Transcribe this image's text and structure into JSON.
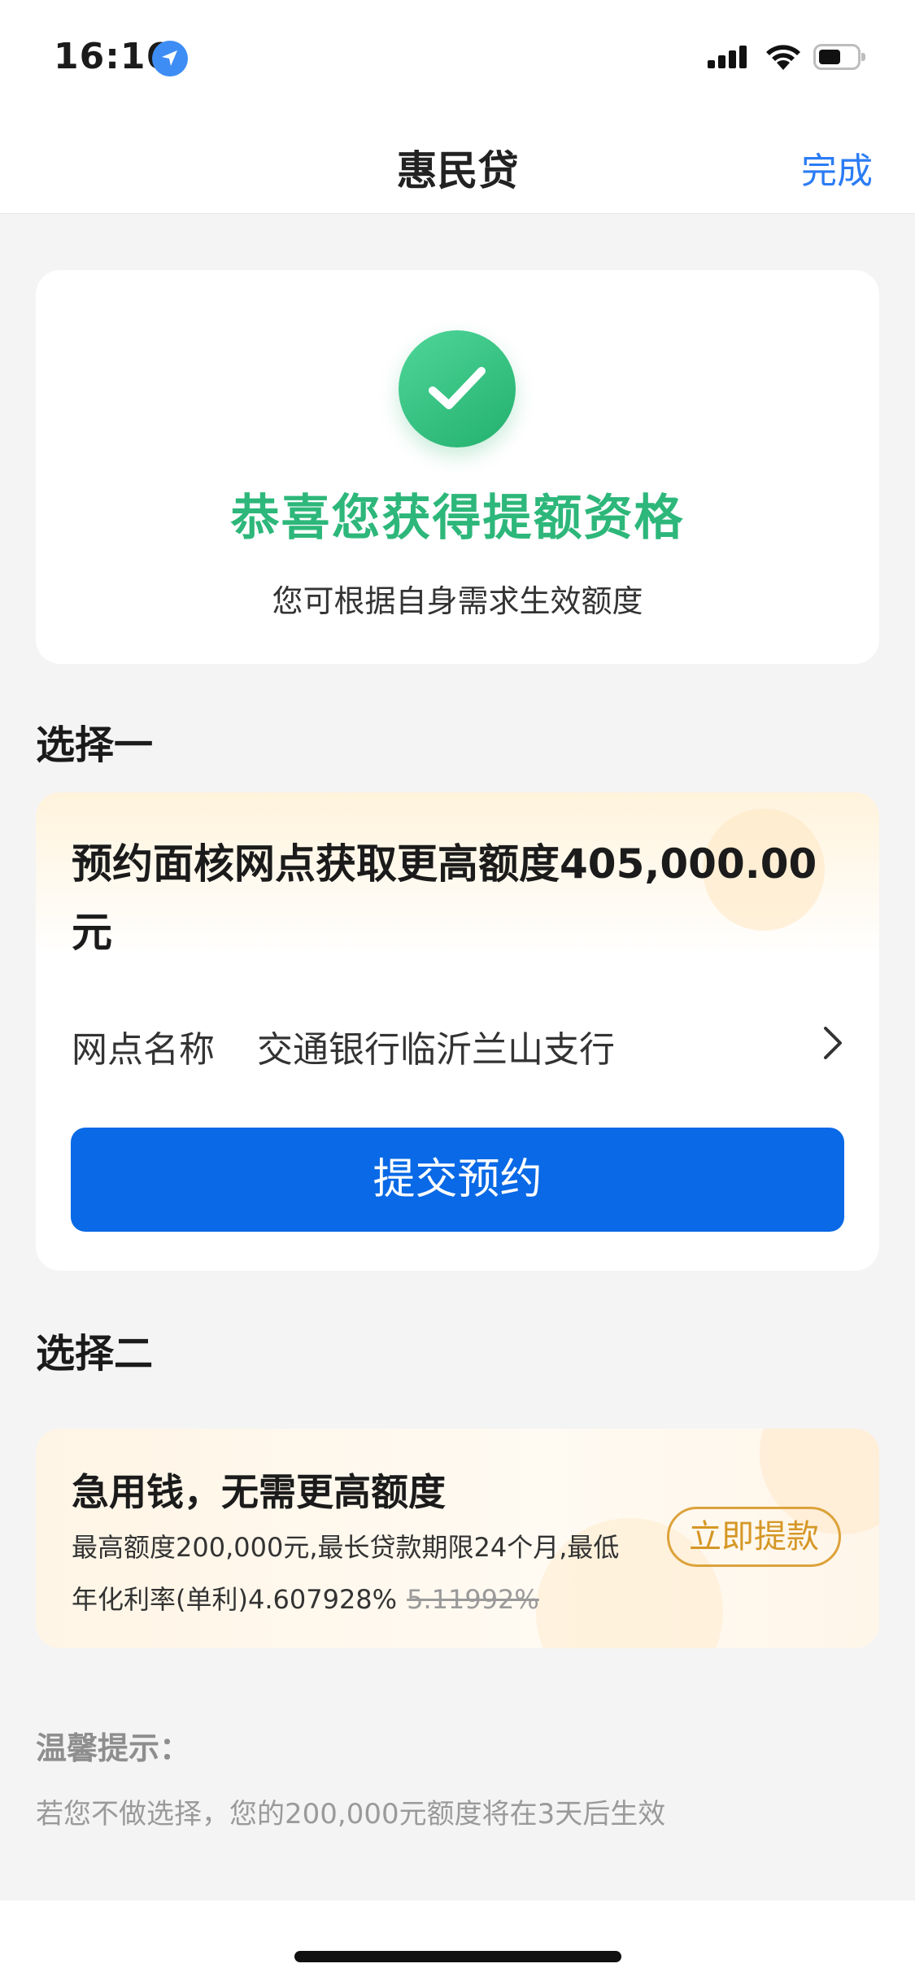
{
  "status_bar": {
    "time": "16:16"
  },
  "nav": {
    "title": "惠民贷",
    "done_label": "完成"
  },
  "success": {
    "title": "恭喜您获得提额资格",
    "subtitle": "您可根据自身需求生效额度"
  },
  "option1": {
    "section_title": "选择一",
    "title": "预约面核网点获取更高额度405,000.00元",
    "branch_label": "网点名称",
    "branch_name": "交通银行临沂兰山支行",
    "submit_label": "提交预约"
  },
  "option2": {
    "section_title": "选择二",
    "title": "急用钱，无需更高额度",
    "desc_line1": "最高额度200,000元,最长贷款期限24个月,最低",
    "desc_line2": "年化利率(单利)4.607928%",
    "old_rate": "5.11992%",
    "withdraw_label": "立即提款"
  },
  "tip": {
    "title": "温馨提示：",
    "text": "若您不做选择，您的200,000元额度将在3天后生效"
  },
  "colors": {
    "primary_blue": "#0969e6",
    "success_green": "#2db77a",
    "accent_gold": "#d59725"
  },
  "icons": [
    "location-arrow-icon",
    "signal-icon",
    "wifi-icon",
    "battery-icon",
    "checkmark-icon",
    "chevron-right-icon"
  ]
}
